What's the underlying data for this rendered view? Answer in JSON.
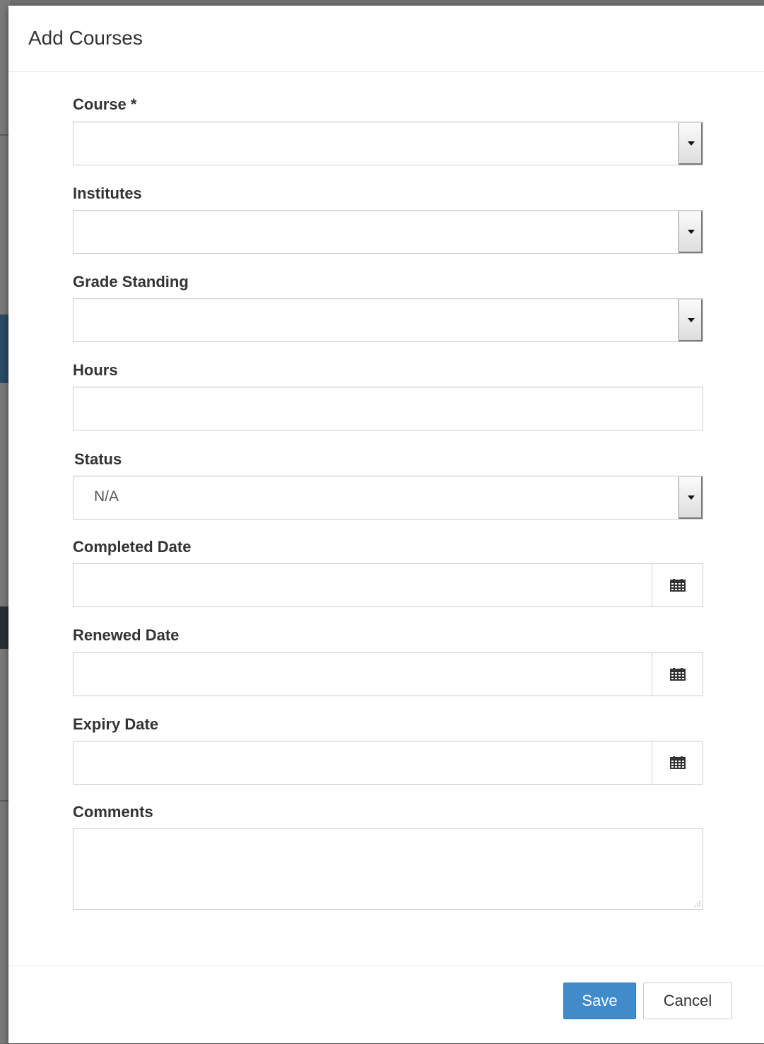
{
  "modal": {
    "title": "Add Courses"
  },
  "form": {
    "course": {
      "label": "Course *",
      "value": ""
    },
    "institutes": {
      "label": "Institutes",
      "value": ""
    },
    "grade_standing": {
      "label": "Grade Standing",
      "value": ""
    },
    "hours": {
      "label": "Hours",
      "value": ""
    },
    "status": {
      "label": "Status",
      "value": "N/A"
    },
    "completed_date": {
      "label": "Completed Date",
      "value": ""
    },
    "renewed_date": {
      "label": "Renewed Date",
      "value": ""
    },
    "expiry_date": {
      "label": "Expiry Date",
      "value": ""
    },
    "comments": {
      "label": "Comments",
      "value": ""
    }
  },
  "footer": {
    "save_label": "Save",
    "cancel_label": "Cancel"
  },
  "icons": {
    "dropdown": "chevron-down-icon",
    "date_picker": "calendar-icon",
    "resize": "resize-grip-icon"
  },
  "colors": {
    "primary": "#428bca",
    "border": "#cccccc",
    "text": "#333333"
  }
}
